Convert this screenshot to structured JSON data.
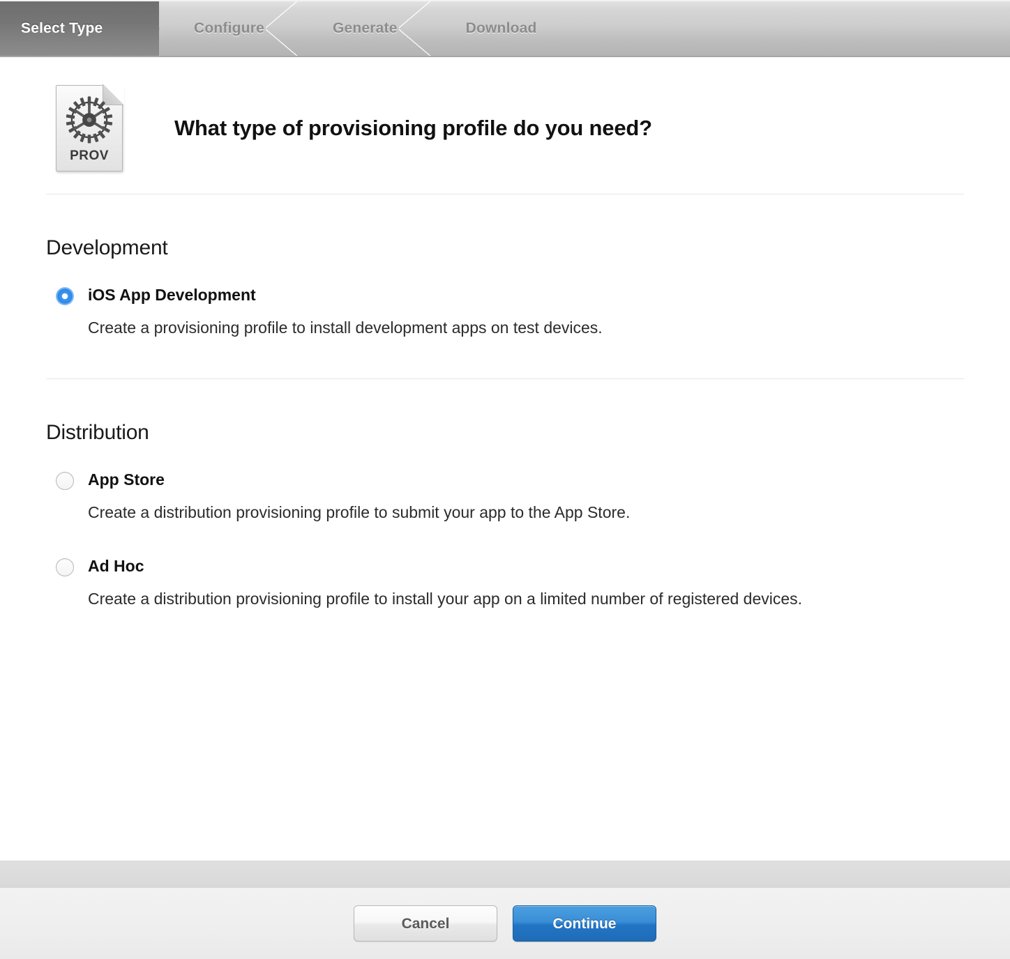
{
  "stepbar": {
    "steps": [
      {
        "label": "Select Type",
        "state": "active"
      },
      {
        "label": "Configure",
        "state": "idle"
      },
      {
        "label": "Generate",
        "state": "idle"
      },
      {
        "label": "Download",
        "state": "idle"
      }
    ]
  },
  "header": {
    "icon_name": "provisioning-profile-icon",
    "icon_text": "PROV",
    "title": "What type of provisioning profile do you need?"
  },
  "sections": [
    {
      "title": "Development",
      "options": [
        {
          "label": "iOS App Development",
          "description": "Create a provisioning profile to install development apps on test devices.",
          "selected": true
        }
      ]
    },
    {
      "title": "Distribution",
      "options": [
        {
          "label": "App Store",
          "description": "Create a distribution provisioning profile to submit your app to the App Store.",
          "selected": false
        },
        {
          "label": "Ad Hoc",
          "description": "Create a distribution provisioning profile to install your app on a limited number of registered devices.",
          "selected": false
        }
      ]
    }
  ],
  "footer": {
    "cancel_label": "Cancel",
    "continue_label": "Continue"
  },
  "colors": {
    "accent_blue": "#2f86e4",
    "continue_button": "#2275c4",
    "stepbar_active": "#767676",
    "stepbar_text_idle": "#8c8c8c",
    "title_text": "#111111"
  }
}
